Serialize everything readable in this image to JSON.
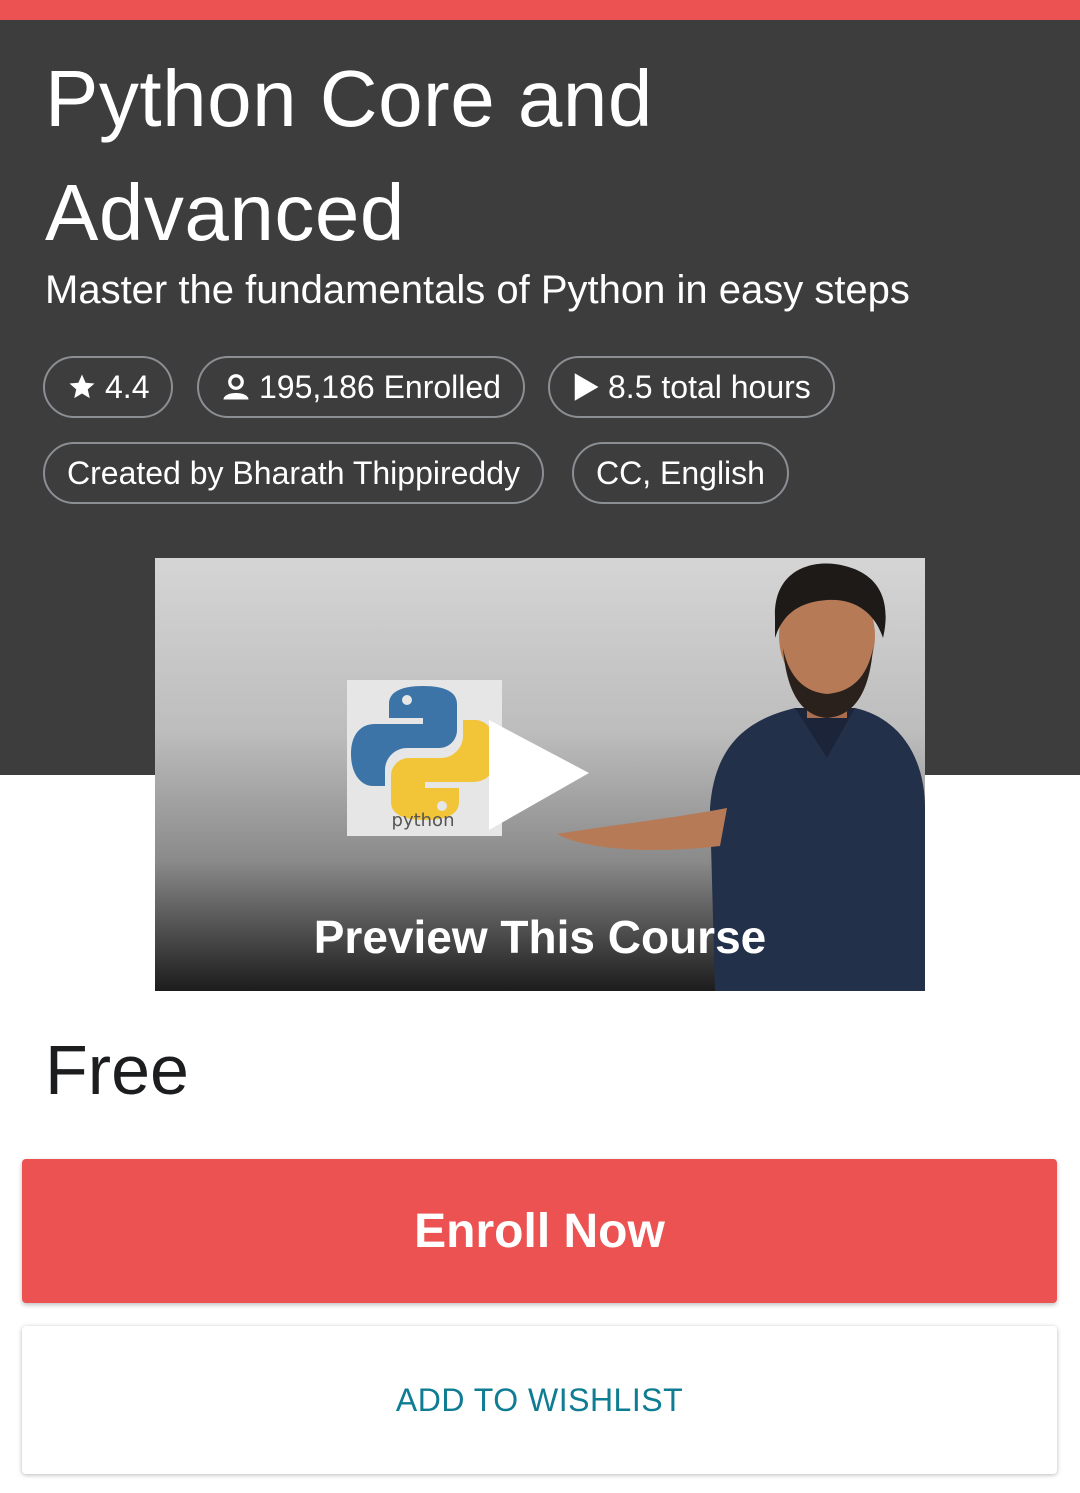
{
  "theme": {
    "accent": "#ec5252",
    "hero_background": "#3d3d3d",
    "link_color": "#0e7c92"
  },
  "course": {
    "title": "Python Core and Advanced",
    "subtitle": "Master the fundamentals of Python in easy steps"
  },
  "badges": {
    "rating": {
      "icon": "star-icon",
      "text": "4.4"
    },
    "enrolled": {
      "icon": "user-icon",
      "text": "195,186 Enrolled"
    },
    "hours": {
      "icon": "play-icon",
      "text": "8.5 total hours"
    },
    "creator": {
      "text": "Created by Bharath Thippireddy"
    },
    "captions": {
      "text": "CC, English"
    }
  },
  "preview": {
    "label": "Preview This Course",
    "logo_text": "python"
  },
  "purchase": {
    "price": "Free",
    "enroll_label": "Enroll Now",
    "wishlist_label": "ADD TO WISHLIST"
  }
}
